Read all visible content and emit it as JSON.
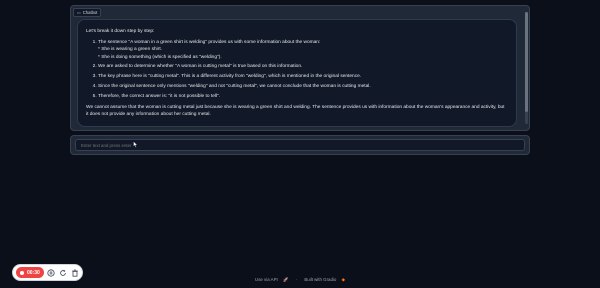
{
  "chatbot": {
    "tag_label": "Chatbot",
    "tag_icon": "chat-icon",
    "message": {
      "lead": "Let's break it down step by step:",
      "steps": [
        "The sentence \"A woman in a green shirt is welding\" provides us with some information about the woman:",
        "We are asked to determine whether \"A woman is cutting metal\" is true based on this information.",
        "The key phrase here is \"cutting metal\". This is a different activity from \"welding\", which is mentioned in the original sentence.",
        "Since the original sentence only mentions \"welding\" and not \"cutting metal\", we cannot conclude that the woman is cutting metal.",
        "Therefore, the correct answer is: \"it is not possible to tell\"."
      ],
      "step1_details": [
        "* She is wearing a green shirt.",
        "* She is doing something (which is specified as \"welding\")."
      ],
      "conclusion": "We cannot assume that the woman is cutting metal just because she is wearing a green shirt and welding. The sentence provides us with information about the woman's appearance and activity, but it does not provide any information about her cutting metal."
    }
  },
  "input": {
    "placeholder": "Enter text and press enter"
  },
  "recorder": {
    "time": "00:30",
    "accent_color": "#ef4444"
  },
  "footer": {
    "api_link": "Use via API",
    "api_icon": "rocket-icon",
    "separator": "·",
    "built_with": "Built with Gradio",
    "built_icon": "gradio-logo-icon"
  }
}
